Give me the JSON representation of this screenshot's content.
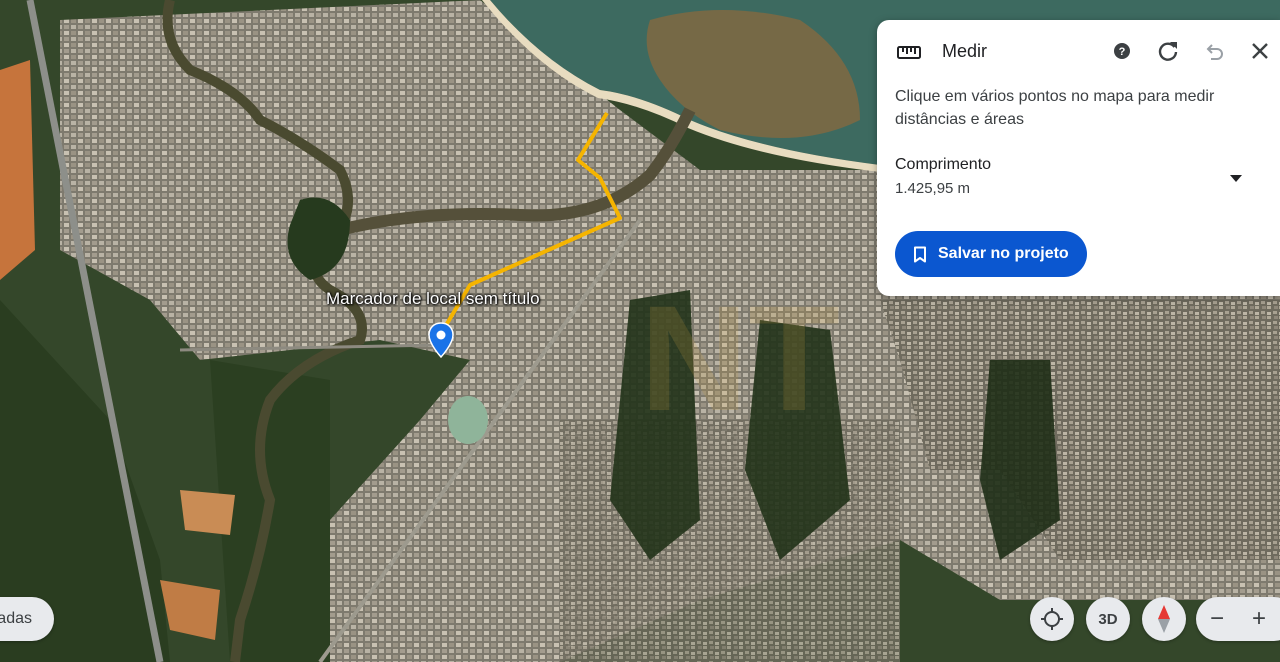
{
  "map": {
    "marker_label": "Marcador de local sem título",
    "watermark": "NT"
  },
  "measure_panel": {
    "title": "Medir",
    "instructions": "Clique em vários pontos no mapa para medir distâncias e áreas",
    "length_label": "Comprimento",
    "length_value": "1.425,95 m",
    "save_label": "Salvar no projeto",
    "icons": [
      "ruler-icon",
      "help-icon",
      "refresh-icon",
      "undo-icon",
      "close-icon",
      "chevron-down-icon",
      "bookmark-icon"
    ]
  },
  "controls": {
    "left_pill_label": "adas",
    "view_3d_label": "3D",
    "zoom_out_label": "−",
    "zoom_in_label": "+",
    "icons": [
      "location-icon",
      "compass-icon"
    ]
  },
  "colors": {
    "accent": "#0b57d0",
    "measure_line": "#f5b400",
    "pin": "#1a73e8",
    "compass_red": "#e53935"
  }
}
